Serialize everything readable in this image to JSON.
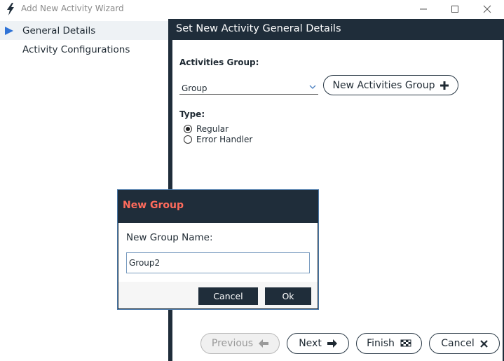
{
  "window": {
    "title": "Add New Activity Wizard",
    "accent_color": "#1f2d3a"
  },
  "nav": {
    "items": [
      {
        "label": "General Details",
        "selected": true
      },
      {
        "label": "Activity Configurations",
        "selected": false
      }
    ]
  },
  "main": {
    "header": "Set New Activity General Details",
    "group_label": "Activities Group:",
    "group_value": "Group",
    "new_group_button": "New Activities Group",
    "type_label": "Type:",
    "type_options": [
      {
        "label": "Regular",
        "checked": true
      },
      {
        "label": "Error Handler",
        "checked": false
      }
    ]
  },
  "footer": {
    "previous": "Previous",
    "next": "Next",
    "finish": "Finish",
    "cancel": "Cancel"
  },
  "dialog": {
    "title": "New Group",
    "title_color": "#ff6b5c",
    "field_label": "New Group Name:",
    "field_value": "Group2",
    "cancel": "Cancel",
    "ok": "Ok"
  }
}
